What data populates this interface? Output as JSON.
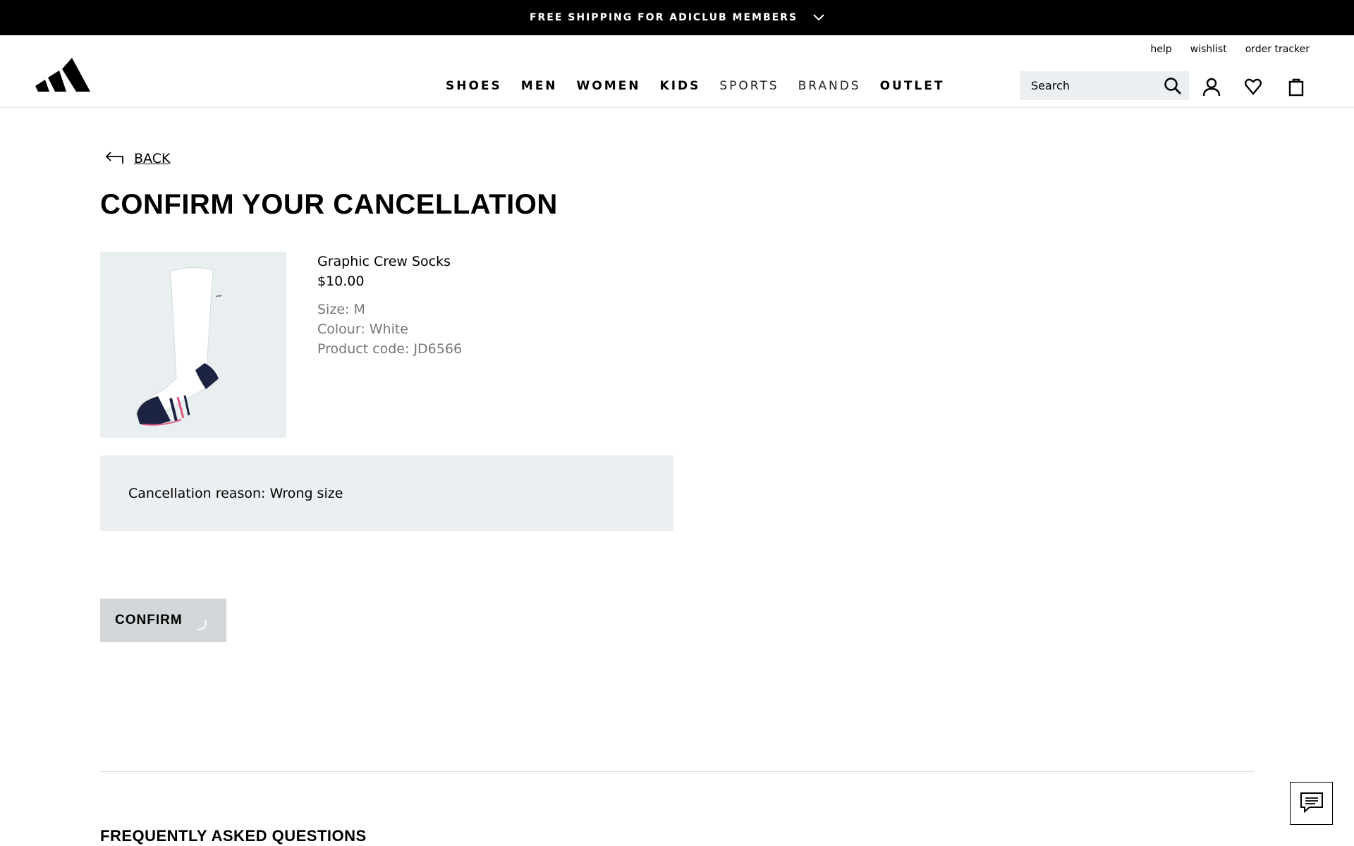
{
  "promo": {
    "text": "FREE SHIPPING FOR ADICLUB MEMBERS",
    "chevron_icon": "chevron-down-icon"
  },
  "header": {
    "logo": "adidas-logo",
    "util_links": [
      "help",
      "wishlist",
      "order tracker"
    ],
    "nav": [
      {
        "label": "SHOES",
        "style": "bold"
      },
      {
        "label": "MEN",
        "style": "bold"
      },
      {
        "label": "WOMEN",
        "style": "bold"
      },
      {
        "label": "KIDS",
        "style": "bold"
      },
      {
        "label": "SPORTS",
        "style": "light"
      },
      {
        "label": "BRANDS",
        "style": "light"
      },
      {
        "label": "OUTLET",
        "style": "bold"
      }
    ],
    "search": {
      "placeholder": "Search",
      "icon": "search-icon"
    },
    "icons": [
      "account-icon",
      "wishlist-heart-icon",
      "bag-icon"
    ]
  },
  "main": {
    "back_label": "BACK",
    "title": "CONFIRM YOUR CANCELLATION",
    "product": {
      "name": "Graphic Crew Socks",
      "price": "$10.00",
      "size": "Size: M",
      "colour": "Colour: White",
      "code": "Product code: JD6566"
    },
    "reason": "Cancellation reason: Wrong size",
    "confirm_label": "CONFIRM",
    "faq_title": "FREQUENTLY ASKED QUESTIONS"
  },
  "colors": {
    "promo_bg": "#000000",
    "box_bg": "#eceff1",
    "button_bg": "#d3d7da",
    "meta_text": "#767677"
  }
}
